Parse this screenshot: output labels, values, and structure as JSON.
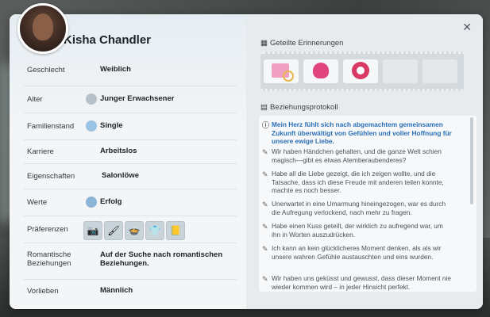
{
  "sim": {
    "name": "Kisha Chandler"
  },
  "details": [
    {
      "label": "Geschlecht",
      "value": "Weiblich"
    },
    {
      "label": "Alter",
      "value": "Junger Erwachsener"
    },
    {
      "label": "Familienstand",
      "value": "Single"
    },
    {
      "label": "Karriere",
      "value": "Arbeitslos"
    },
    {
      "label": "Eigenschaften",
      "value": "Salonlöwe"
    },
    {
      "label": "Werte",
      "value": "Erfolg"
    },
    {
      "label": "Präferenzen",
      "value": ""
    },
    {
      "label": "Romantische Beziehungen",
      "value": "Auf der Suche nach romantischen Beziehungen."
    },
    {
      "label": "Vorlieben",
      "value": "Männlich"
    }
  ],
  "preferences_icons": [
    "camera-icon",
    "brush-icon",
    "food-icon",
    "shirt-icon",
    "book-icon"
  ],
  "shared_memories": {
    "title": "Geteilte Erinnerungen",
    "items": [
      "calendar-heart-icon",
      "heart-couple-icon",
      "heart-badge-icon",
      "empty",
      "empty"
    ]
  },
  "relationship_log": {
    "title": "Beziehungsprotokoll",
    "entries": [
      {
        "text": "Mein Herz fühlt sich nach abgemachtem gemeinsamen Zukunft überwältigt von Gefühlen und voller Hoffnung für unsere ewige Liebe.",
        "highlight": true
      },
      {
        "text": "Wir haben Händchen gehalten, und die ganze Welt schien magisch—gibt es etwas Atemberaubenderes?",
        "highlight": false
      },
      {
        "text": "Habe all die Liebe gezeigt, die ich zeigen wollte, und die Tatsache, dass ich diese Freude mit anderen teilen konnte, machte es noch besser.",
        "highlight": false
      },
      {
        "text": "Unerwartet in eine Umarmung hineingezogen, war es durch die Aufregung verlockend, nach mehr zu fragen.",
        "highlight": false
      },
      {
        "text": "Habe einen Kuss geteilt, der wirklich zu aufregend war, um ihn in Worten auszudrücken.",
        "highlight": false
      },
      {
        "text": "Ich kann an kein glücklicheres Moment denken, als als wir unsere wahren Gefühle austauschten und eins wurden.",
        "highlight": false
      },
      {
        "text": "Wir haben uns geküsst und gewusst, dass dieser Moment nie wieder kommen wird – in jeder Hinsicht perfekt.",
        "highlight": false
      }
    ]
  },
  "close_label": "✕"
}
